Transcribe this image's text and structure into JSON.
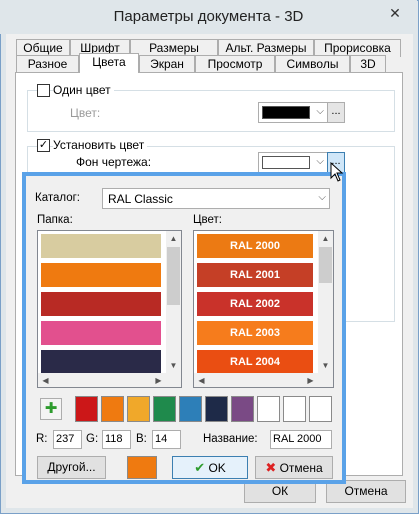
{
  "window": {
    "title": "Параметры документа - 3D",
    "close_glyph": "✕"
  },
  "tabs_row1": [
    "Общие",
    "Шрифт",
    "Размеры",
    "Альт. Размеры",
    "Прорисовка"
  ],
  "tabs_row2": [
    "Разное",
    "Цвета",
    "Экран",
    "Просмотр",
    "Символы",
    "3D"
  ],
  "active_tab": "Цвета",
  "single_color": {
    "label": "Один цвет",
    "checked": false,
    "color_label": "Цвет:",
    "swatch": "#000000"
  },
  "set_color": {
    "label": "Установить цвет",
    "checked": true,
    "bg_label": "Фон чертежа:",
    "swatch": "#ffffff"
  },
  "popup": {
    "catalog_label": "Каталог:",
    "catalog_value": "RAL Classic",
    "folder_label": "Папка:",
    "color_label": "Цвет:",
    "folders": [
      {
        "color": "#d8cca0"
      },
      {
        "color": "#ef7a10"
      },
      {
        "color": "#b82a24"
      },
      {
        "color": "#e2508e"
      },
      {
        "color": "#2a2a48"
      }
    ],
    "colors": [
      {
        "name": "RAL 2000",
        "color": "#ec7a13"
      },
      {
        "name": "RAL 2001",
        "color": "#c53f26"
      },
      {
        "name": "RAL 2002",
        "color": "#c9322a"
      },
      {
        "name": "RAL 2003",
        "color": "#f67c1c"
      },
      {
        "name": "RAL 2004",
        "color": "#ea4e12"
      }
    ],
    "palette": [
      "#cc1718",
      "#ef7a10",
      "#f0a82a",
      "#1f8a4c",
      "#2d7fb8",
      "#1e2a48",
      "#7a4a85",
      "#ffffff",
      "#ffffff",
      "#ffffff"
    ],
    "add_glyph": "✚",
    "r_label": "R:",
    "r_value": "237",
    "g_label": "G:",
    "g_value": "118",
    "b_label": "B:",
    "b_value": "14",
    "name_label": "Название:",
    "name_value": "RAL 2000",
    "other_button": "Другой...",
    "current_swatch": "#ef7a10",
    "ok_button": "OK",
    "cancel_button": "Отмена"
  },
  "footer": {
    "ok": "ОК",
    "cancel": "Отмена"
  }
}
